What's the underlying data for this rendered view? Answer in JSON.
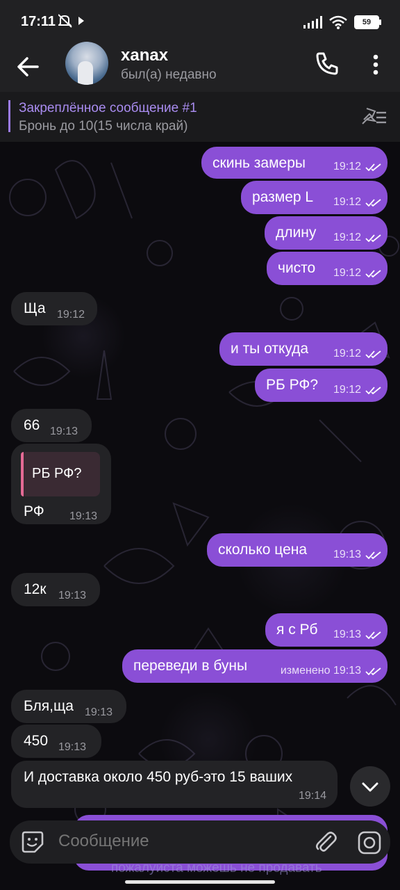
{
  "status": {
    "time": "17:11",
    "battery": "59"
  },
  "header": {
    "title": "xanax",
    "subtitle": "был(а) недавно"
  },
  "pinned": {
    "title": "Закреплённое сообщение #1",
    "text": "Бронь до 10(15 числа край)"
  },
  "messages": [
    {
      "text": "скинь замеры",
      "time": "19:12"
    },
    {
      "text": "размер L",
      "time": "19:12"
    },
    {
      "text": "длину",
      "time": "19:12"
    },
    {
      "text": "чисто",
      "time": "19:12"
    },
    {
      "text": "Ща",
      "time": "19:12"
    },
    {
      "text": "и ты откуда",
      "time": "19:12"
    },
    {
      "text": "РБ РФ?",
      "time": "19:12"
    },
    {
      "text": "66",
      "time": "19:13"
    },
    {
      "reply": "РБ РФ?",
      "text": "РФ",
      "time": "19:13"
    },
    {
      "text": "сколько цена",
      "time": "19:13"
    },
    {
      "text": "12к",
      "time": "19:13"
    },
    {
      "text": "я с Рб",
      "time": "19:13"
    },
    {
      "text": "переведи в буны",
      "edited": "изменено",
      "time": "19:13"
    },
    {
      "text": "Бля,ща",
      "time": "19:13"
    },
    {
      "text": "450",
      "time": "19:13"
    },
    {
      "text": "И доставка около 450 руб-это 15 ваших",
      "time": "19:14"
    }
  ],
  "input": {
    "placeholder": "Сообщение"
  },
  "hidden_message": {
    "text": "пожалуйста можешь не продавать"
  }
}
